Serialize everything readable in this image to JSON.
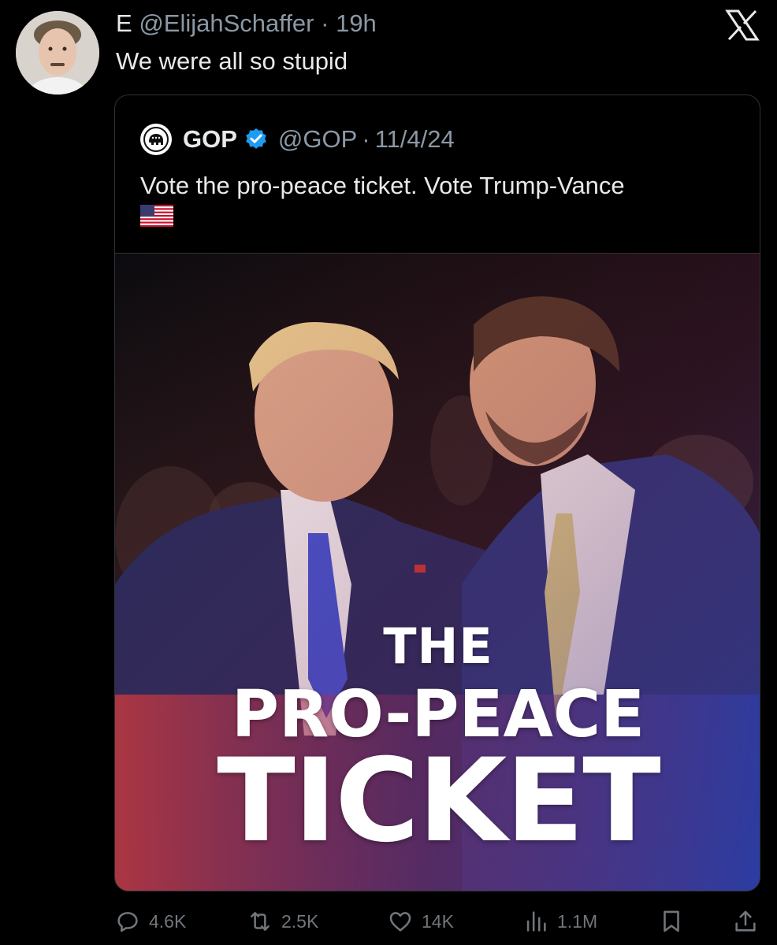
{
  "tweet": {
    "author_name": "E",
    "author_handle": "@ElijahSchaffer",
    "separator": "·",
    "time": "19h",
    "text": "We were all so stupid"
  },
  "quote": {
    "name": "GOP",
    "handle": "@GOP",
    "separator": "·",
    "date": "11/4/24",
    "text": "Vote the pro-peace ticket. Vote Trump-Vance",
    "flag_emoji": "🇺🇸",
    "media": {
      "headline_line1": "THE",
      "headline_line2": "PRO-PEACE",
      "headline_line3": "TICKET"
    }
  },
  "actions": {
    "replies": "4.6K",
    "reposts": "2.5K",
    "likes": "14K",
    "views": "1.1M"
  },
  "colors": {
    "background": "#000000",
    "text_primary": "#e7e9ea",
    "text_secondary": "#8b98a5",
    "verified_blue": "#1d9bf0",
    "border": "#2f3336"
  },
  "icons": [
    "x-logo-icon",
    "verified-badge-icon",
    "reply-icon",
    "repost-icon",
    "like-icon",
    "views-icon",
    "bookmark-icon",
    "share-icon"
  ]
}
